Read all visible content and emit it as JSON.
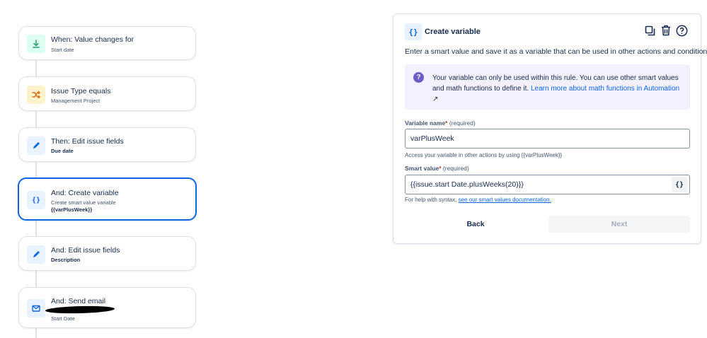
{
  "steps": [
    {
      "title": "When: Value changes for",
      "subtitle": "Start date",
      "icon": "download-arrow-icon",
      "color": "#22a06b",
      "bg": "#dcfff1"
    },
    {
      "title": "Issue Type equals",
      "subtitle": "Management Project",
      "icon": "shuffle-icon",
      "color": "#e56910",
      "bg": "#fff3cc"
    },
    {
      "title": "Then: Edit issue fields",
      "subtitle": "Due date",
      "icon": "pencil-icon",
      "color": "#0c66e4",
      "bg": "#e9f2ff"
    },
    {
      "title": "And: Create variable",
      "subtitle": "Create smart value variable",
      "subtitle2": "{{varPlusWeek}}",
      "icon": "braces-icon"
    },
    {
      "title": "And: Edit issue fields",
      "subtitle": "Description",
      "icon": "pencil-icon"
    },
    {
      "title": "And: Send email",
      "subtitle": "Start Date",
      "icon": "mail-icon"
    }
  ],
  "panel": {
    "icon_text": "{}",
    "title": "Create variable",
    "description": "Enter a smart value and save it as a variable that can be used in other actions and conditions.",
    "info_text": "Your variable can only be used within this rule. You can use other smart values and math functions to define it.",
    "info_link": "Learn more about math functions in Automation",
    "info_link_suffix": "↗",
    "variable_name_label": "Variable name",
    "required_marker": "*",
    "required_text": "(required)",
    "variable_name_value": "varPlusWeek",
    "variable_helper": "Access your variable in other actions by using {{varPlusWeek}}",
    "smart_value_label": "Smart value",
    "smart_value_value": "{{issue.start Date.plusWeeks(20)}}",
    "smart_value_button": "{}",
    "syntax_helper": "For help with syntax,",
    "syntax_link": "see our smart values documentation.",
    "back_label": "Back",
    "next_label": "Next"
  },
  "colors": {
    "accent": "#0c66e4",
    "info_bg": "#f3f0ff",
    "info_icon": "#6e5dc6"
  }
}
